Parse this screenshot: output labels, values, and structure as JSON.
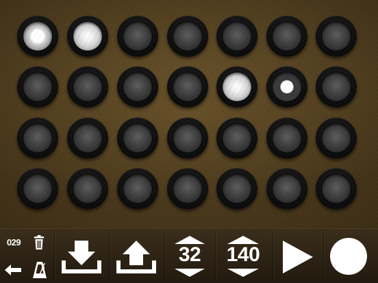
{
  "app": {
    "screen": "step-sequencer"
  },
  "grid": {
    "rows": 4,
    "cols": 7,
    "pads": [
      [
        "lit-core",
        "lit-soft",
        "off",
        "off",
        "off",
        "off",
        "off"
      ],
      [
        "off",
        "off",
        "off",
        "off",
        "lit-soft",
        "lit-dot",
        "off"
      ],
      [
        "off",
        "off",
        "off",
        "off",
        "off",
        "off",
        "off"
      ],
      [
        "off",
        "off",
        "off",
        "off",
        "off",
        "off",
        "off"
      ]
    ]
  },
  "toolbar": {
    "pattern_number": "029",
    "tempo_steps": "32",
    "bpm": "140",
    "icons": {
      "delete": "trash-icon",
      "back": "back-arrow-icon",
      "metronome": "metronome-icon",
      "download": "download-icon",
      "upload": "upload-icon",
      "play": "play-icon",
      "record": "record-icon"
    }
  },
  "colors": {
    "background_top": "#5a4522",
    "background_edge": "#261b0b",
    "toolbar": "#2b2114",
    "icon": "#ffffff"
  }
}
